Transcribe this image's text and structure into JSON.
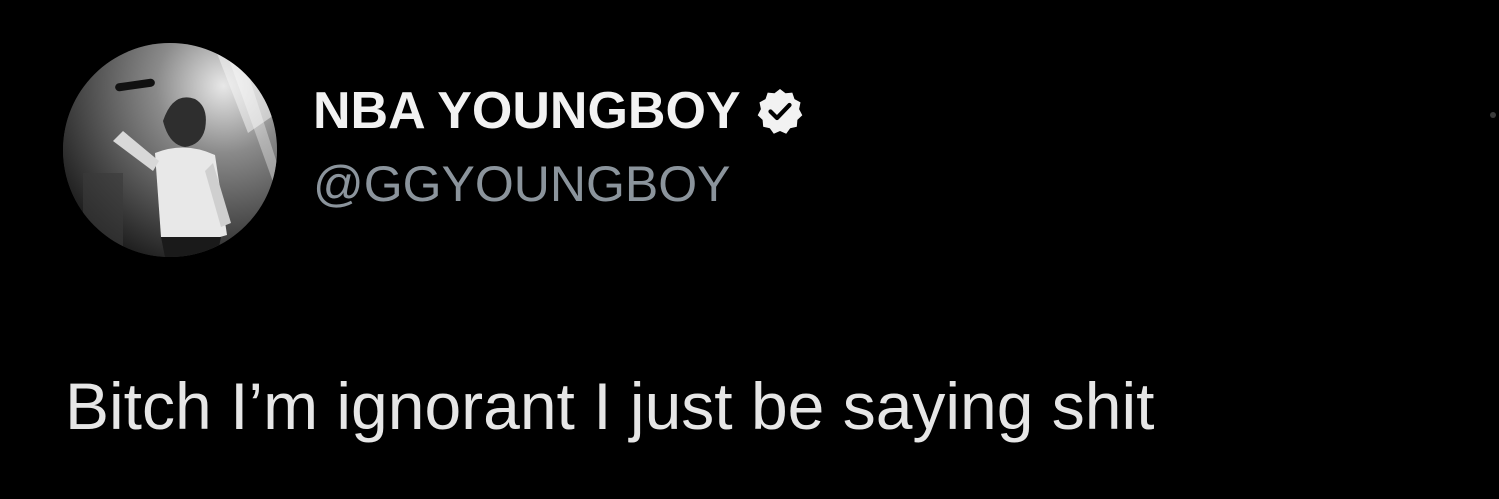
{
  "user": {
    "display_name": "NBA YOUNGBOY",
    "handle": "@GGYOUNGBOY",
    "verified": true
  },
  "tweet": {
    "text": "Bitch I’m ignorant I just be saying shit"
  },
  "icons": {
    "avatar": "profile-photo-icon",
    "verified": "verified-badge-icon",
    "more": "more-options-icon"
  },
  "colors": {
    "background": "#000000",
    "display_name": "#f2f2f2",
    "handle": "#8b949c",
    "tweet_text": "#e6e6e6"
  }
}
